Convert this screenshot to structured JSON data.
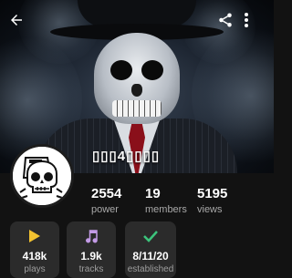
{
  "header": {
    "back_icon": "arrow-left-icon",
    "share_icon": "share-icon",
    "more_icon": "more-vertical-icon"
  },
  "crew": {
    "name": "▯▯▯4▯▯▯▯",
    "avatar_icon": "skull-avatar-icon"
  },
  "stats": [
    {
      "value": "2554",
      "label": "power"
    },
    {
      "value": "19",
      "label": "members"
    },
    {
      "value": "5195",
      "label": "views"
    }
  ],
  "cards": [
    {
      "icon": "play-icon",
      "icon_color": "#f2c230",
      "value": "418k",
      "label": "plays"
    },
    {
      "icon": "music-note-icon",
      "icon_color": "#c39be6",
      "value": "1.9k",
      "label": "tracks"
    },
    {
      "icon": "check-icon",
      "icon_color": "#3cc47c",
      "value": "8/11/20",
      "label": "established"
    }
  ],
  "colors": {
    "background": "#121212",
    "card": "#2b2b2b",
    "muted_text": "#a8a8a8"
  }
}
